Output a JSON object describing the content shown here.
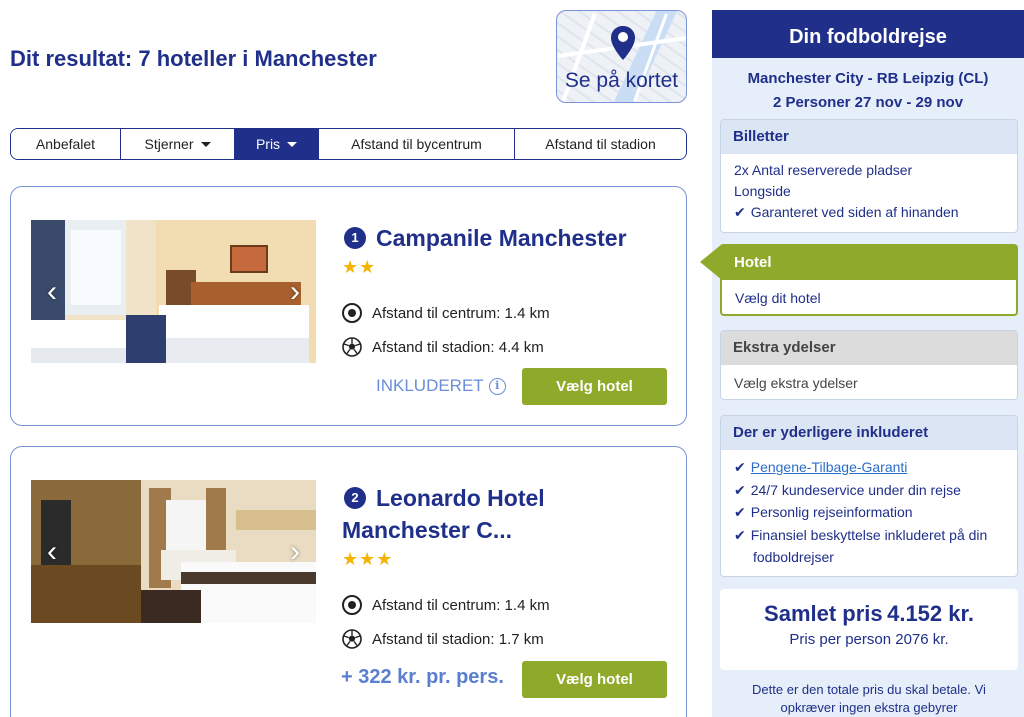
{
  "header": {
    "result_title": "Dit resultat: 7 hoteller i Manchester",
    "map_button_label": "Se på kortet"
  },
  "sort_tabs": [
    {
      "label": "Anbefalet",
      "active": false,
      "has_caret": false
    },
    {
      "label": "Stjerner",
      "active": false,
      "has_caret": true
    },
    {
      "label": "Pris",
      "active": true,
      "has_caret": true
    },
    {
      "label": "Afstand til bycentrum",
      "active": false,
      "has_caret": false
    },
    {
      "label": "Afstand til stadion",
      "active": false,
      "has_caret": false
    }
  ],
  "hotels": [
    {
      "number": "1",
      "name": "Campanile Manchester",
      "stars": "★★",
      "star_count": 2,
      "distance_center": "Afstand til centrum: 1.4 km",
      "distance_stadium": "Afstand til stadion: 4.4 km",
      "price_label": "INKLUDERET",
      "select_label": "Vælg hotel"
    },
    {
      "number": "2",
      "name_line1": "Leonardo Hotel",
      "name_line2": "Manchester C...",
      "stars": "★★★",
      "star_count": 3,
      "distance_center": "Afstand til centrum: 1.4 km",
      "distance_stadium": "Afstand til stadion: 1.7 km",
      "price_label": "+ 322 kr. pr. pers.",
      "select_label": "Vælg hotel"
    }
  ],
  "sidebar": {
    "title": "Din fodboldrejse",
    "match": "Manchester City - RB Leipzig (CL)",
    "trip_details": "2 Personer 27 nov - 29 nov",
    "tickets": {
      "heading": "Billetter",
      "line1": "2x Antal reserverede pladser",
      "line2": "Longside",
      "line3": "Garanteret ved siden af hinanden"
    },
    "hotel": {
      "heading": "Hotel",
      "body": "Vælg dit hotel"
    },
    "extras": {
      "heading": "Ekstra ydelser",
      "body": "Vælg ekstra ydelser"
    },
    "included": {
      "heading": "Der er yderligere inkluderet",
      "item1": "Pengene-Tilbage-Garanti",
      "item2": "24/7 kundeservice under din rejse",
      "item3": "Personlig rejseinformation",
      "item4_line1": "Finansiel beskyttelse inkluderet på din",
      "item4_line2": "fodboldrejser"
    },
    "total": {
      "label": "Samlet pris",
      "value": "4.152 kr.",
      "per_person": "Pris per person 2076 kr."
    },
    "footer_line1": "Dette er den totale pris du skal betale. Vi",
    "footer_line2": "opkræver ingen ekstra gebyrer"
  },
  "colors": {
    "navy": "#1f2f8a",
    "green": "#8faa2b",
    "light_blue_bg": "#e6eef9",
    "star": "#f4b400",
    "link": "#2a6ec8"
  }
}
